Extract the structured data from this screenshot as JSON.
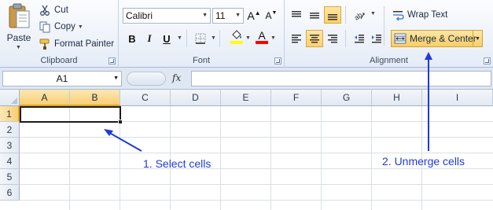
{
  "clipboard": {
    "group_label": "Clipboard",
    "paste_label": "Paste",
    "cut_label": "Cut",
    "copy_label": "Copy",
    "format_painter_label": "Format Painter"
  },
  "font": {
    "group_label": "Font",
    "font_name": "Calibri",
    "font_size": "11",
    "bold": "B",
    "italic": "I",
    "underline": "U",
    "grow": "A",
    "shrink": "A",
    "font_color_letter": "A",
    "fill_color": "#ffff00",
    "font_color": "#ff0000"
  },
  "alignment": {
    "group_label": "Alignment",
    "wrap_text_label": "Wrap Text",
    "merge_center_label": "Merge & Center",
    "active_color": "#fbd16a"
  },
  "formula_bar": {
    "name_box": "A1",
    "fx_label": "fx",
    "formula_value": ""
  },
  "sheet": {
    "columns": [
      "A",
      "B",
      "C",
      "D",
      "E",
      "F",
      "G",
      "H",
      "I"
    ],
    "rows": [
      "1",
      "2",
      "3",
      "4",
      "5",
      "6"
    ],
    "selected_columns": [
      "A",
      "B"
    ],
    "selected_row": "1",
    "selection_header_color": "#f7cf75"
  },
  "annotations": {
    "step1": "1. Select cells",
    "step2": "2. Unmerge cells",
    "color": "#1f3bd6"
  }
}
